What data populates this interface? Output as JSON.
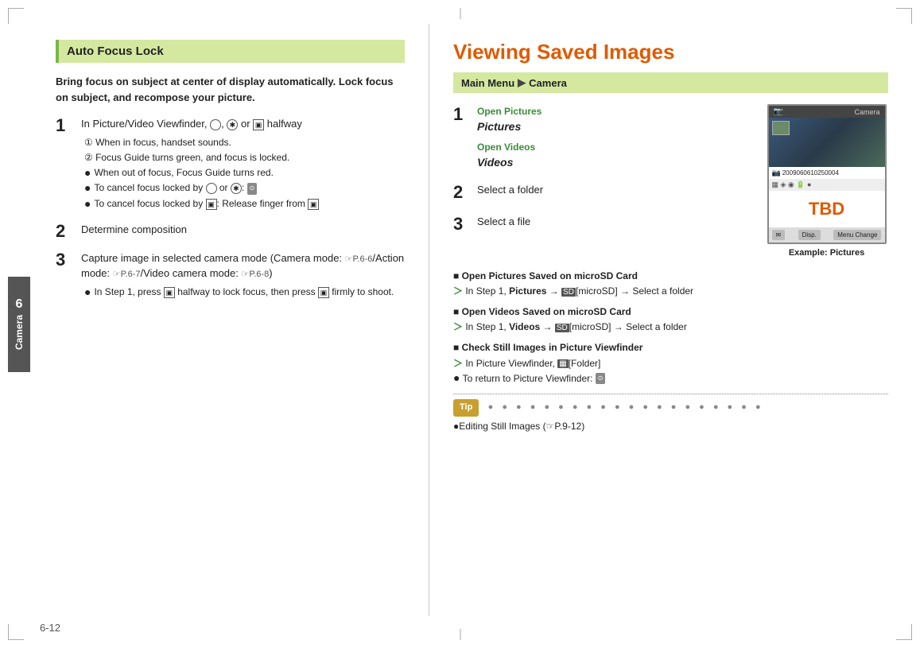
{
  "page": {
    "number": "6-12",
    "tab_num": "6",
    "tab_label": "Camera"
  },
  "left": {
    "heading": "Auto Focus Lock",
    "intro": "Bring focus on subject at center of display automatically. Lock focus on subject, and recompose your picture.",
    "steps": [
      {
        "num": "1",
        "text": "In Picture/Video Viewfinder,",
        "icons": "circle, asterisk or square(cam) halfway",
        "sub_notes": [
          {
            "type": "circled",
            "num": "①",
            "text": "When in focus, handset sounds."
          },
          {
            "type": "circled",
            "num": "②",
            "text": "Focus Guide turns green, and focus is locked."
          },
          {
            "type": "bullet",
            "text": "When out of focus, Focus Guide turns red."
          },
          {
            "type": "bullet",
            "text": "To cancel focus locked by circle or asterisk:"
          },
          {
            "type": "bullet",
            "text": "To cancel focus locked by square(cam): Release finger from square(cam)"
          }
        ]
      },
      {
        "num": "2",
        "text": "Determine composition"
      },
      {
        "num": "3",
        "text": "Capture image in selected camera mode (Camera mode: P.6-6/Action mode: P.6-7/Video camera mode: P.6-8)",
        "sub_notes": [
          {
            "type": "bullet",
            "text": "In Step 1, press square(cam) halfway to lock focus, then press square(cam) firmly to shoot."
          }
        ]
      }
    ]
  },
  "right": {
    "title": "Viewing Saved Images",
    "breadcrumb": {
      "prefix": "Main Menu",
      "arrow": "▶",
      "item": "Camera"
    },
    "steps": [
      {
        "num": "1",
        "green_label_1": "Open Pictures",
        "bold_label_1": "Pictures",
        "green_label_2": "Open Videos",
        "bold_label_2": "Videos"
      },
      {
        "num": "2",
        "text": "Select a folder"
      },
      {
        "num": "3",
        "text": "Select a file"
      }
    ],
    "camera_screen": {
      "top_bar_left": "Camera",
      "info_code": "2009060610250004",
      "tbd_label": "TBD",
      "btn_left": "✉",
      "btn_center": "Disp.",
      "btn_right": "Menu Change"
    },
    "camera_caption": "Example: Pictures",
    "notes": [
      {
        "heading": "■ Open Pictures Saved on microSD Card",
        "text": "In Step 1, Pictures → [microSD] → Select a folder"
      },
      {
        "heading": "■ Open Videos Saved on microSD Card",
        "text": "In Step 1, Videos → [microSD] → Select a folder"
      },
      {
        "heading": "■ Check Still Images in Picture Viewfinder",
        "text": "In Picture Viewfinder, [Folder]",
        "sub": "To return to Picture Viewfinder:"
      }
    ],
    "tip": {
      "label": "Tip",
      "text": "●Editing Still Images (☞P.9-12)"
    }
  }
}
